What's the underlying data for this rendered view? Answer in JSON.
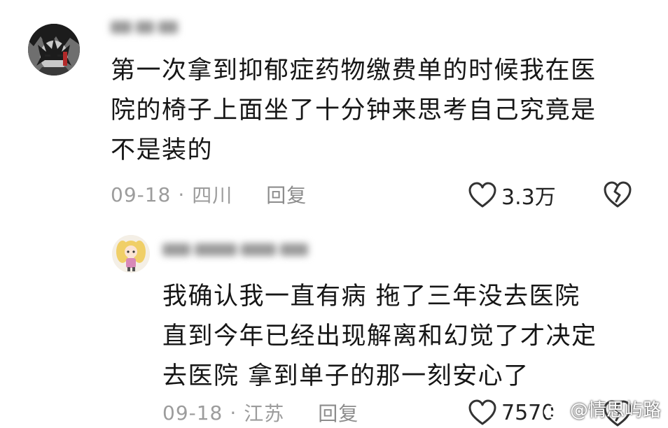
{
  "comments": [
    {
      "avatar": "anime-boy-avatar",
      "username": "",
      "text": "第一次拿到抑郁症药物缴费单的时候我在医\n院的椅子上面坐了十分钟来思考自己究竟是\n不是装的",
      "date": "09-18",
      "location": "四川",
      "reply_label": "回复",
      "likes": "3.3万"
    },
    {
      "avatar": "anime-girl-avatar",
      "username": "",
      "text": "我确认我一直有病 拖了三年没去医院\n直到今年已经出现解离和幻觉了才决定\n去医院 拿到单子的那一刻安心了",
      "date": "09-18",
      "location": "江苏",
      "reply_label": "回复",
      "likes": "7570"
    }
  ],
  "meta_separator": "·",
  "watermark": {
    "text": "@情思屿路",
    "icon": "weibo-icon"
  },
  "colors": {
    "text": "#161616",
    "meta": "#9c9c9c",
    "background": "#ffffff"
  }
}
